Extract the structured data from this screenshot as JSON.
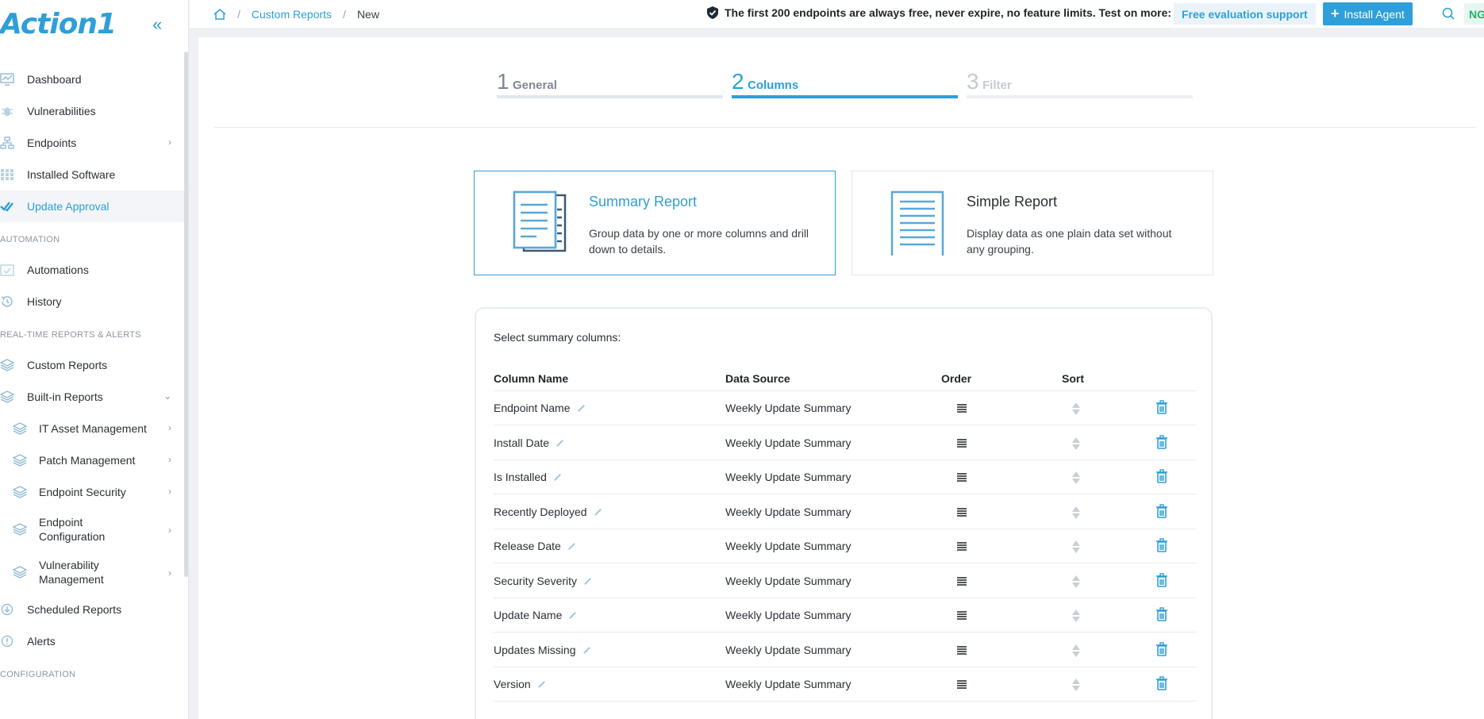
{
  "app": {
    "logo_text": "Action1"
  },
  "sidebar": {
    "collapse_icon": "chevrons-left-icon",
    "items": [
      {
        "label": "Dashboard",
        "icon": "dashboard-icon"
      },
      {
        "label": "Vulnerabilities",
        "icon": "bug-icon"
      },
      {
        "label": "Endpoints",
        "icon": "network-icon"
      },
      {
        "label": "Installed Software",
        "icon": "grid-icon"
      },
      {
        "label": "Update Approval",
        "icon": "double-check-icon"
      }
    ],
    "section_automation": "AUTOMATION",
    "automation_items": [
      {
        "label": "Automations",
        "icon": "calendar-check-icon"
      },
      {
        "label": "History",
        "icon": "history-icon"
      }
    ],
    "section_reports": "REAL-TIME REPORTS & ALERTS",
    "report_items": [
      {
        "label": "Custom Reports",
        "icon": "layers-icon"
      },
      {
        "label": "Built-in Reports",
        "icon": "layers-icon"
      }
    ],
    "builtin_sub": [
      {
        "label": "IT Asset Management"
      },
      {
        "label": "Patch Management"
      },
      {
        "label": "Endpoint Security"
      },
      {
        "label": "Endpoint Configuration"
      },
      {
        "label": "Vulnerability Management"
      }
    ],
    "after_items": [
      {
        "label": "Scheduled Reports",
        "icon": "clock-download-icon"
      },
      {
        "label": "Alerts",
        "icon": "alert-circle-icon"
      }
    ],
    "section_config": "CONFIGURATION"
  },
  "topbar": {
    "breadcrumbs": [
      "Custom Reports",
      "New"
    ],
    "promo": "The first 200 endpoints are always free, never expire, no feature limits. Test on more:",
    "eval_label": "Free evaluation support",
    "install_label": "Install Agent",
    "avatar": "NG"
  },
  "wizard": {
    "steps": [
      {
        "num": "1",
        "label": "General"
      },
      {
        "num": "2",
        "label": "Columns"
      },
      {
        "num": "3",
        "label": "Filter"
      }
    ]
  },
  "report_types": [
    {
      "title": "Summary Report",
      "desc": "Group data by one or more columns and drill down to details."
    },
    {
      "title": "Simple Report",
      "desc": "Display data as one plain data set without any grouping."
    }
  ],
  "columns": {
    "heading": "Select summary columns:",
    "headers": [
      "Column Name",
      "Data Source",
      "Order",
      "Sort"
    ],
    "rows": [
      {
        "name": "Endpoint Name",
        "source": "Weekly Update Summary"
      },
      {
        "name": "Install Date",
        "source": "Weekly Update Summary"
      },
      {
        "name": "Is Installed",
        "source": "Weekly Update Summary"
      },
      {
        "name": "Recently Deployed",
        "source": "Weekly Update Summary"
      },
      {
        "name": "Release Date",
        "source": "Weekly Update Summary"
      },
      {
        "name": "Security Severity",
        "source": "Weekly Update Summary"
      },
      {
        "name": "Update Name",
        "source": "Weekly Update Summary"
      },
      {
        "name": "Updates Missing",
        "source": "Weekly Update Summary"
      },
      {
        "name": "Version",
        "source": "Weekly Update Summary"
      }
    ]
  },
  "colors": {
    "accent": "#2e9fd8",
    "avatar_green": "#1fb36a"
  }
}
